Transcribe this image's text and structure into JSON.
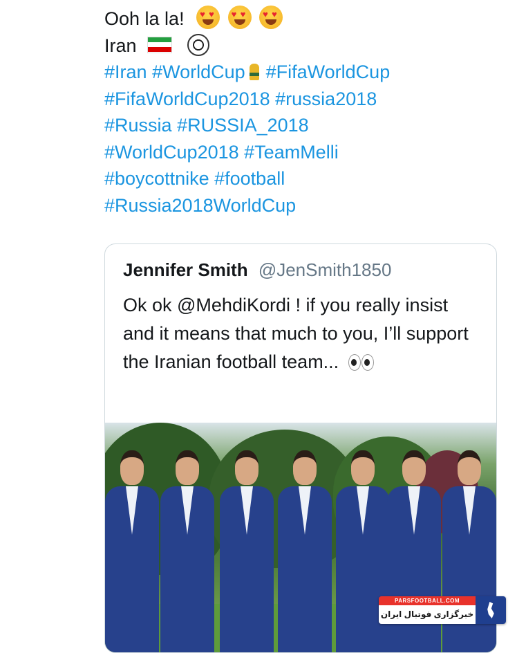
{
  "tweet": {
    "line1": "Ooh la la!",
    "line2": "Iran",
    "hashtags": {
      "iran": "#Iran",
      "worldcup": "#WorldCup",
      "fifaworldcup": "#FifaWorldCup",
      "fifaworldcup2018": "#FifaWorldCup2018",
      "russia2018": "#russia2018",
      "russia": "#Russia",
      "russia_2018": "#RUSSIA_2018",
      "worldcup2018": "#WorldCup2018",
      "teammelli": "#TeamMelli",
      "boycottnike": "#boycottnike",
      "football": "#football",
      "russia2018worldcup": "#Russia2018WorldCup"
    },
    "emoji": {
      "heart_eyes": "heart-eyes-emoji",
      "flag": "iran-flag-icon",
      "ball": "soccer-ball-icon",
      "trophy": "world-cup-trophy-icon"
    }
  },
  "quote": {
    "name": "Jennifer Smith",
    "handle": "@JenSmith1850",
    "body": "Ok ok @MehdiKordi ! if you really insist and it means that much to you, I’ll support the Iranian football team...",
    "body_emoji": "eyes-emoji"
  },
  "watermark": {
    "site": "PARSFOOTBALL.COM",
    "tagline": "خبرگزاری فوتبال ایران"
  },
  "colors": {
    "text": "#14171a",
    "hashtag": "#1b95e0",
    "handle": "#657786",
    "border": "#cfd9de",
    "suit": "#27418c",
    "watermark_red": "#e8322b",
    "watermark_blue": "#1f3f8f"
  }
}
